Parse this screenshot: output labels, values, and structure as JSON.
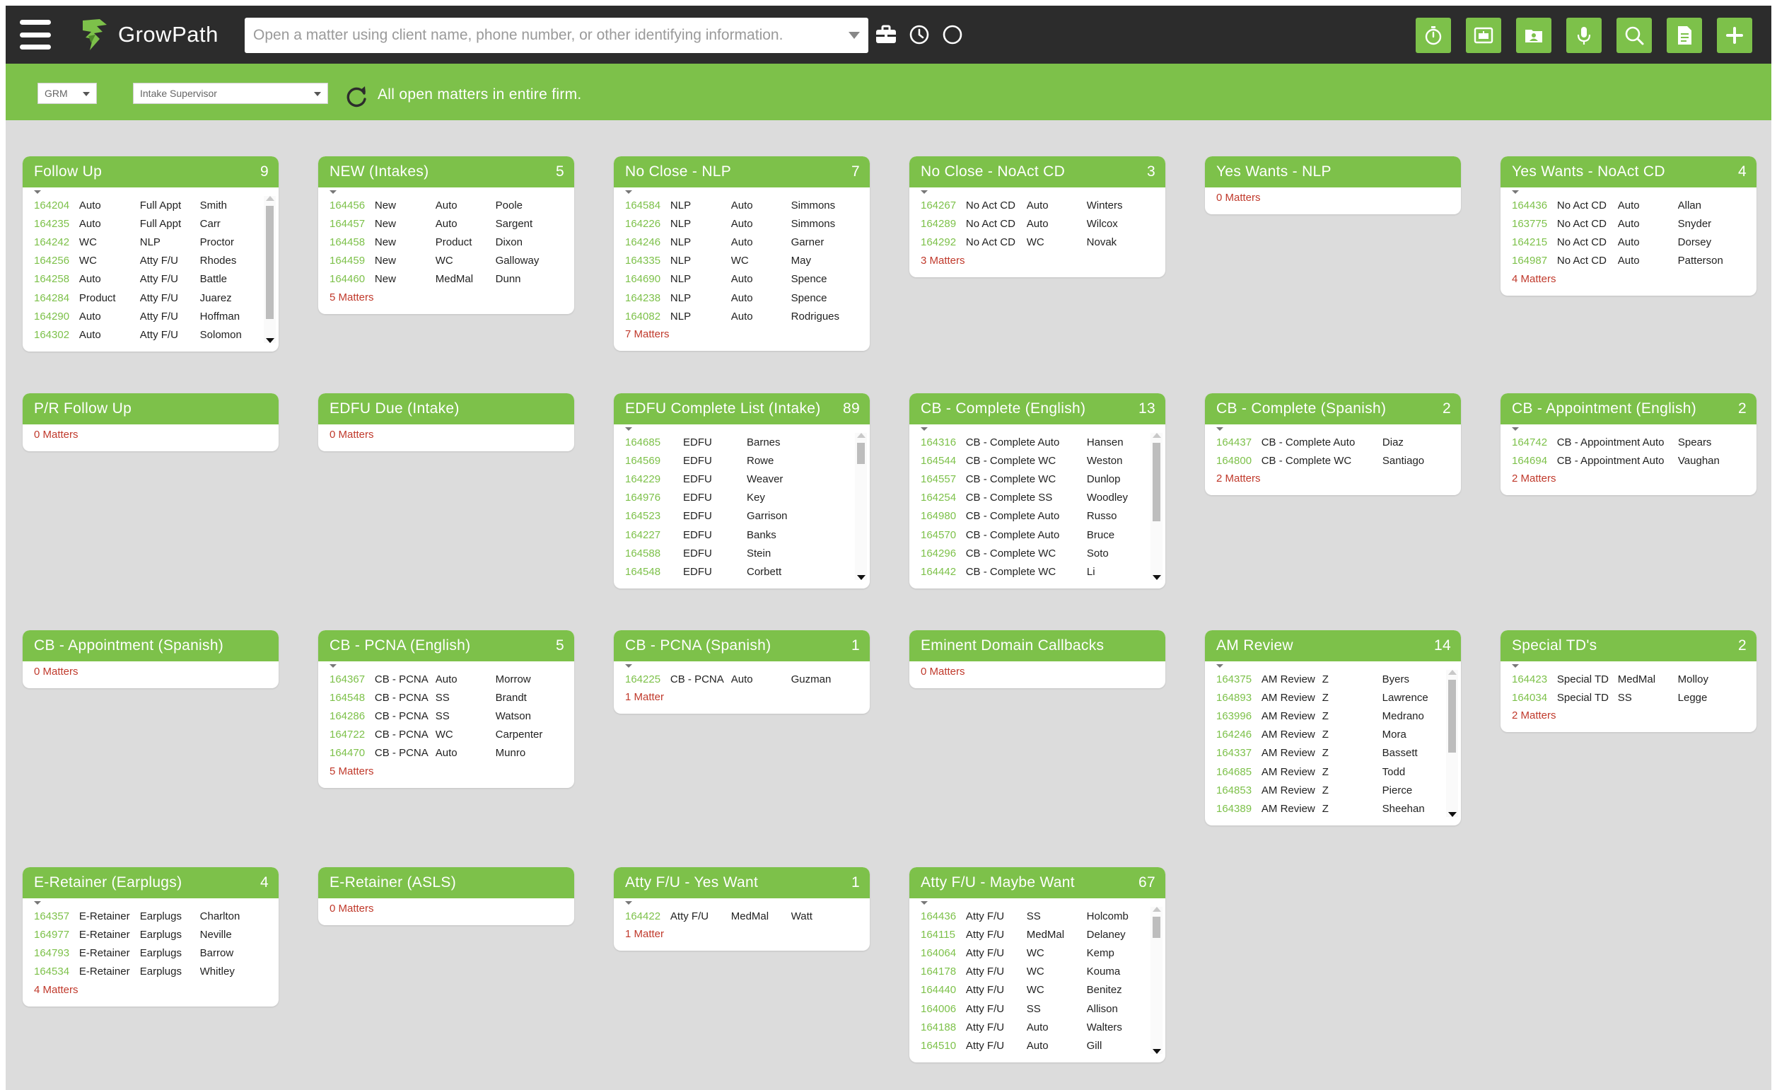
{
  "app": {
    "name": "GrowPath",
    "search_placeholder": "Open a matter using client name, phone number, or other identifying information."
  },
  "icons": {
    "menu": "menu-icon",
    "briefcase": "briefcase-icon",
    "history": "clock-icon",
    "status": "circle-icon",
    "actions": [
      "stopwatch-icon",
      "dashboard-icon",
      "contact-card-icon",
      "microphone-icon",
      "search-icon",
      "document-icon",
      "plus-icon"
    ]
  },
  "colors": {
    "brand_green": "#7dc14a",
    "topbar": "#2c2c2c",
    "background": "#dcdcdc",
    "matter_id": "#7dc14a",
    "matter_summary": "#c0392b"
  },
  "filters": {
    "firm": "GRM",
    "role": "Intake Supervisor",
    "scope_text": "All open matters in entire firm."
  },
  "cards": [
    {
      "title": "Follow Up",
      "count": "9",
      "summary": "",
      "rows": [
        [
          "164204",
          "Auto",
          "Full Appt",
          "Smith"
        ],
        [
          "164235",
          "Auto",
          "Full Appt",
          "Carr"
        ],
        [
          "164242",
          "WC",
          "NLP",
          "Proctor"
        ],
        [
          "164256",
          "WC",
          "Atty F/U",
          "Rhodes"
        ],
        [
          "164258",
          "Auto",
          "Atty F/U",
          "Battle"
        ],
        [
          "164284",
          "Product",
          "Atty F/U",
          "Juarez"
        ],
        [
          "164290",
          "Auto",
          "Atty F/U",
          "Hoffman"
        ],
        [
          "164302",
          "Auto",
          "Atty F/U",
          "Solomon"
        ]
      ]
    },
    {
      "title": "NEW (Intakes)",
      "count": "5",
      "summary": "5 Matters",
      "rows": [
        [
          "164456",
          "New",
          "Auto",
          "Poole"
        ],
        [
          "164457",
          "New",
          "Auto",
          "Sargent"
        ],
        [
          "164458",
          "New",
          "Product",
          "Dixon"
        ],
        [
          "164459",
          "New",
          "WC",
          "Galloway"
        ],
        [
          "164460",
          "New",
          "MedMal",
          "Dunn"
        ]
      ]
    },
    {
      "title": "No Close - NLP",
      "count": "7",
      "summary": "7 Matters",
      "rows": [
        [
          "164584",
          "NLP",
          "Auto",
          "Simmons"
        ],
        [
          "164226",
          "NLP",
          "Auto",
          "Simmons"
        ],
        [
          "164246",
          "NLP",
          "Auto",
          "Garner"
        ],
        [
          "164335",
          "NLP",
          "WC",
          "May"
        ],
        [
          "164690",
          "NLP",
          "Auto",
          "Spence"
        ],
        [
          "164238",
          "NLP",
          "Auto",
          "Spence"
        ],
        [
          "164082",
          "NLP",
          "Auto",
          "Rodrigues"
        ]
      ]
    },
    {
      "title": "No Close - NoAct CD",
      "count": "3",
      "summary": "3 Matters",
      "rows": [
        [
          "164267",
          "No Act CD",
          "Auto",
          "Winters"
        ],
        [
          "164289",
          "No Act CD",
          "Auto",
          "Wilcox"
        ],
        [
          "164292",
          "No Act CD",
          "WC",
          "Novak"
        ]
      ]
    },
    {
      "title": "Yes Wants - NLP",
      "count": "",
      "summary": "0 Matters",
      "rows": []
    },
    {
      "title": "Yes Wants - NoAct CD",
      "count": "4",
      "summary": "4 Matters",
      "rows": [
        [
          "164436",
          "No Act CD",
          "Auto",
          "Allan"
        ],
        [
          "163775",
          "No Act CD",
          "Auto",
          "Snyder"
        ],
        [
          "164215",
          "No Act CD",
          "Auto",
          "Dorsey"
        ],
        [
          "164987",
          "No Act CD",
          "Auto",
          "Patterson"
        ]
      ]
    },
    {
      "title": "P/R Follow Up",
      "count": "",
      "summary": "0 Matters",
      "rows": []
    },
    {
      "title": "EDFU Due (Intake)",
      "count": "",
      "summary": "0 Matters",
      "rows": []
    },
    {
      "title": "EDFU Complete List (Intake)",
      "count": "89",
      "summary": "",
      "rows": [
        [
          "164685",
          "EDFU",
          "Barnes"
        ],
        [
          "164569",
          "EDFU",
          "Rowe"
        ],
        [
          "164229",
          "EDFU",
          "Weaver"
        ],
        [
          "164976",
          "EDFU",
          "Key"
        ],
        [
          "164523",
          "EDFU",
          "Garrison"
        ],
        [
          "164227",
          "EDFU",
          "Banks"
        ],
        [
          "164588",
          "EDFU",
          "Stein"
        ],
        [
          "164548",
          "EDFU",
          "Corbett"
        ]
      ]
    },
    {
      "title": "CB - Complete (English)",
      "count": "13",
      "summary": "",
      "rows": [
        [
          "164316",
          "CB - Complete Auto",
          "Hansen"
        ],
        [
          "164544",
          "CB - Complete WC",
          "Weston"
        ],
        [
          "164557",
          "CB - Complete WC",
          "Dunlop"
        ],
        [
          "164254",
          "CB - Complete SS",
          "Woodley"
        ],
        [
          "164980",
          "CB - Complete Auto",
          "Russo"
        ],
        [
          "164570",
          "CB - Complete Auto",
          "Bruce"
        ],
        [
          "164296",
          "CB - Complete WC",
          "Soto"
        ],
        [
          "164442",
          "CB - Complete WC",
          "Li"
        ]
      ]
    },
    {
      "title": "CB - Complete (Spanish)",
      "count": "2",
      "summary": "2 Matters",
      "rows": [
        [
          "164437",
          "CB - Complete Auto",
          "Diaz"
        ],
        [
          "164800",
          "CB - Complete WC",
          "Santiago"
        ]
      ]
    },
    {
      "title": "CB - Appointment (English)",
      "count": "2",
      "summary": "2 Matters",
      "rows": [
        [
          "164742",
          "CB - Appointment Auto",
          "Spears"
        ],
        [
          "164694",
          "CB - Appointment Auto",
          "Vaughan"
        ]
      ]
    },
    {
      "title": "CB - Appointment (Spanish)",
      "count": "",
      "summary": "0 Matters",
      "rows": []
    },
    {
      "title": "CB - PCNA (English)",
      "count": "5",
      "summary": "5 Matters",
      "rows": [
        [
          "164367",
          "CB - PCNA",
          "Auto",
          "Morrow"
        ],
        [
          "164548",
          "CB - PCNA",
          "SS",
          "Brandt"
        ],
        [
          "164286",
          "CB - PCNA",
          "SS",
          "Watson"
        ],
        [
          "164722",
          "CB - PCNA",
          "WC",
          "Carpenter"
        ],
        [
          "164470",
          "CB - PCNA",
          "Auto",
          "Munro"
        ]
      ]
    },
    {
      "title": "CB - PCNA (Spanish)",
      "count": "1",
      "summary": "1 Matter",
      "rows": [
        [
          "164225",
          "CB - PCNA",
          "Auto",
          "Guzman"
        ]
      ]
    },
    {
      "title": "Eminent Domain Callbacks",
      "count": "",
      "summary": "0 Matters",
      "rows": []
    },
    {
      "title": "AM Review",
      "count": "14",
      "summary": "",
      "rows": [
        [
          "164375",
          "AM Review",
          "Z",
          "Byers"
        ],
        [
          "164893",
          "AM Review",
          "Z",
          "Lawrence"
        ],
        [
          "163996",
          "AM Review",
          "Z",
          "Medrano"
        ],
        [
          "164246",
          "AM Review",
          "Z",
          "Mora"
        ],
        [
          "164337",
          "AM Review",
          "Z",
          "Bassett"
        ],
        [
          "164685",
          "AM Review",
          "Z",
          "Todd"
        ],
        [
          "164853",
          "AM Review",
          "Z",
          "Pierce"
        ],
        [
          "164389",
          "AM Review",
          "Z",
          "Sheehan"
        ]
      ]
    },
    {
      "title": "Special TD's",
      "count": "2",
      "summary": "2 Matters",
      "rows": [
        [
          "164423",
          "Special TD",
          "MedMal",
          "Molloy"
        ],
        [
          "164034",
          "Special TD",
          "SS",
          "Legge"
        ]
      ]
    },
    {
      "title": "E-Retainer (Earplugs)",
      "count": "4",
      "summary": "4 Matters",
      "rows": [
        [
          "164357",
          "E-Retainer",
          "Earplugs",
          "Charlton"
        ],
        [
          "164977",
          "E-Retainer",
          "Earplugs",
          "Neville"
        ],
        [
          "164793",
          "E-Retainer",
          "Earplugs",
          "Barrow"
        ],
        [
          "164534",
          "E-Retainer",
          "Earplugs",
          "Whitley"
        ]
      ]
    },
    {
      "title": "E-Retainer (ASLS)",
      "count": "",
      "summary": "0 Matters",
      "rows": []
    },
    {
      "title": "Atty F/U - Yes Want",
      "count": "1",
      "summary": "1 Matter",
      "rows": [
        [
          "164422",
          "Atty F/U",
          "MedMal",
          "Watt"
        ]
      ]
    },
    {
      "title": "Atty F/U - Maybe Want",
      "count": "67",
      "summary": "",
      "rows": [
        [
          "164436",
          "Atty F/U",
          "SS",
          "Holcomb"
        ],
        [
          "164115",
          "Atty F/U",
          "MedMal",
          "Delaney"
        ],
        [
          "164064",
          "Atty F/U",
          "WC",
          "Kemp"
        ],
        [
          "164178",
          "Atty F/U",
          "WC",
          "Kouma"
        ],
        [
          "164440",
          "Atty F/U",
          "WC",
          "Benitez"
        ],
        [
          "164006",
          "Atty F/U",
          "SS",
          "Allison"
        ],
        [
          "164188",
          "Atty F/U",
          "Auto",
          "Walters"
        ],
        [
          "164510",
          "Atty F/U",
          "Auto",
          "Gill"
        ]
      ]
    }
  ]
}
